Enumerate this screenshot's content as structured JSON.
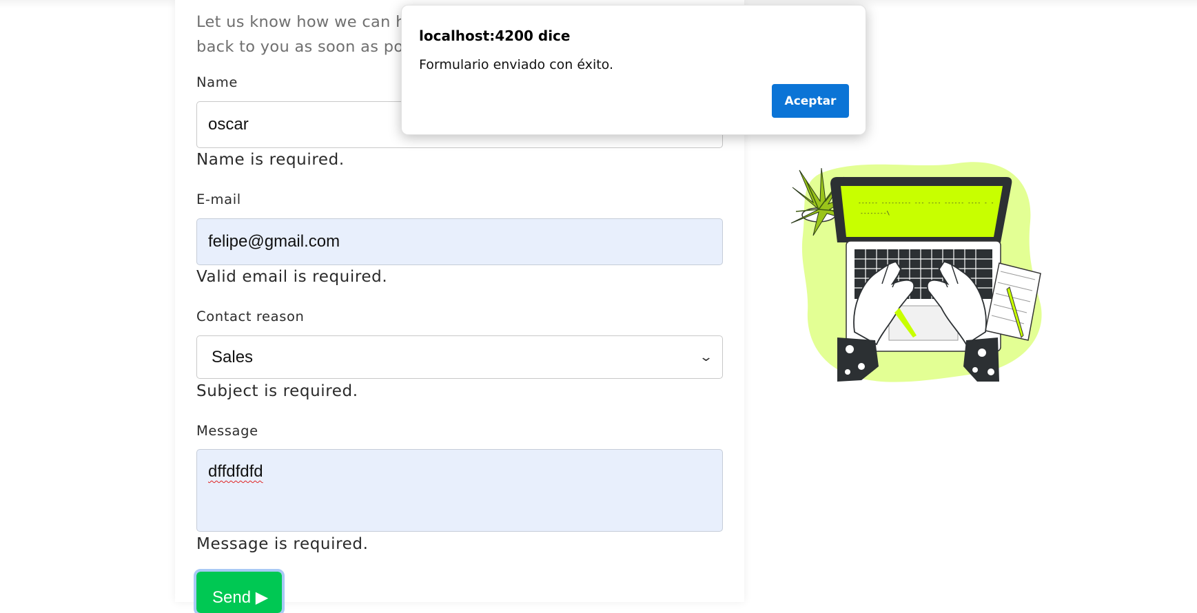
{
  "intro": "Let us know how we can h\nback to you as soon as po",
  "form": {
    "name": {
      "label": "Name",
      "value": "oscar",
      "error": "Name is required."
    },
    "email": {
      "label": "E-mail",
      "value": "felipe@gmail.com",
      "error": "Valid email is required."
    },
    "reason": {
      "label": "Contact reason",
      "value": "Sales",
      "error": "Subject is required."
    },
    "message": {
      "label": "Message",
      "value": "dffdfdfd",
      "error": "Message is required."
    },
    "send_label": "Send ▶"
  },
  "dialog": {
    "title": "localhost:4200 dice",
    "message": "Formulario enviado con éxito.",
    "button_label": "Aceptar"
  },
  "illustration": {
    "icon": "person-typing-on-laptop-illustration",
    "screen_text_line1": "------ --------- --- ----    ------ ---- - -",
    "screen_text_line2": "--------\\"
  },
  "colors": {
    "accent_green": "#00c853",
    "dialog_button": "#0b74d6",
    "illustration_lime": "#c8ff00",
    "autofill_bg": "#e8effc"
  }
}
